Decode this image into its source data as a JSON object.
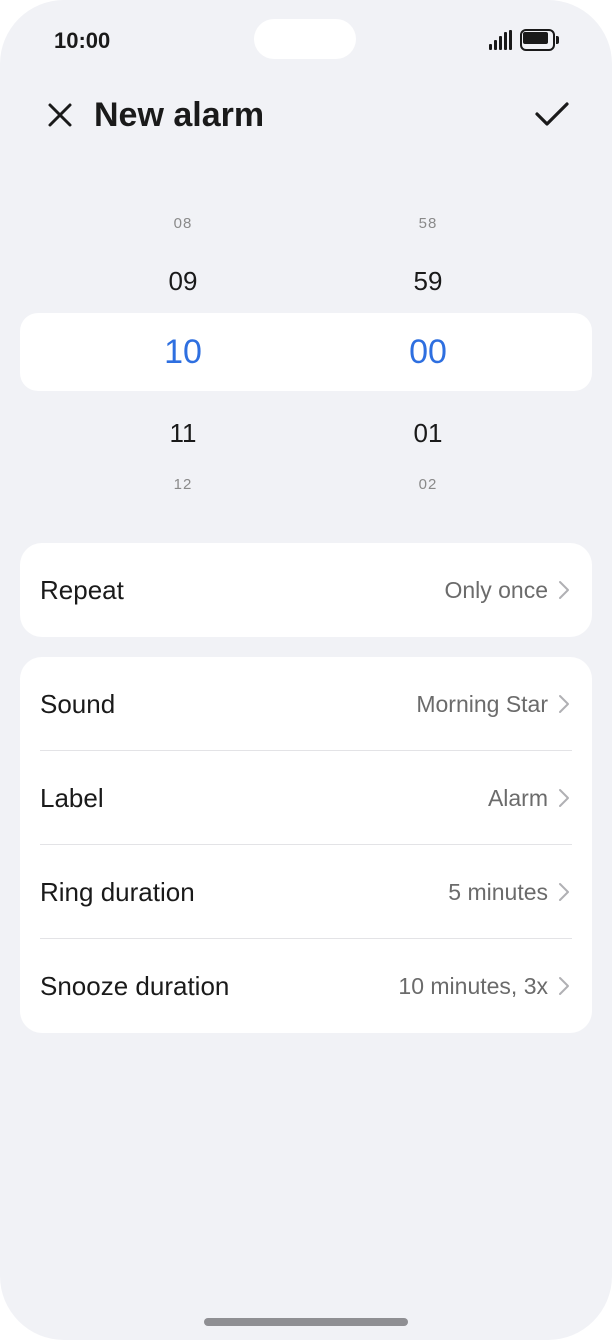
{
  "status_bar": {
    "time": "10:00"
  },
  "header": {
    "title": "New alarm",
    "close_icon": "close-icon",
    "confirm_icon": "check-icon"
  },
  "picker": {
    "hours": {
      "far_above": "08",
      "above": "09",
      "selected": "10",
      "below": "11",
      "far_below": "12"
    },
    "minutes": {
      "far_above": "58",
      "above": "59",
      "selected": "00",
      "below": "01",
      "far_below": "02"
    },
    "selected_color": "#2e6fe0"
  },
  "repeat": {
    "label": "Repeat",
    "value": "Only once"
  },
  "settings": [
    {
      "label": "Sound",
      "value": "Morning Star"
    },
    {
      "label": "Label",
      "value": "Alarm"
    },
    {
      "label": "Ring duration",
      "value": "5 minutes"
    },
    {
      "label": "Snooze duration",
      "value": "10 minutes, 3x"
    }
  ]
}
